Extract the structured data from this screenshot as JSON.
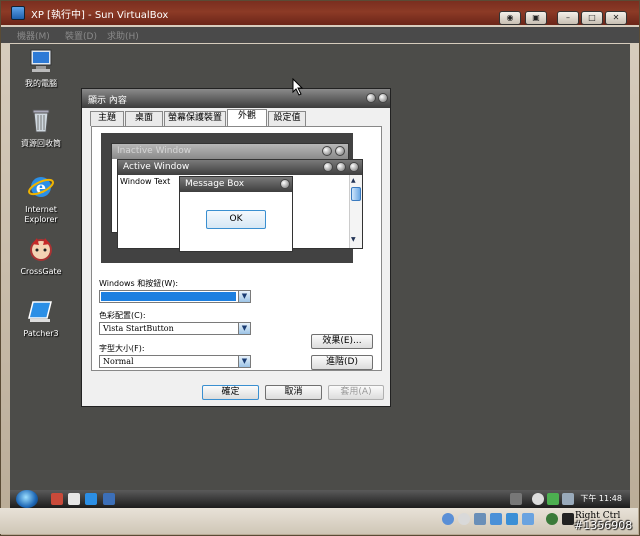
{
  "host": {
    "title": "XP [執行中] - Sun VirtualBox",
    "menu": [
      "機器(M)",
      "裝置(D)",
      "求助(H)"
    ],
    "status_right": "Right Ctrl"
  },
  "desktop": {
    "icons": [
      {
        "label": "我的電腦",
        "icon": "my-computer-icon"
      },
      {
        "label": "資源回收筒",
        "icon": "recycle-bin-icon"
      },
      {
        "label": "Internet\nExplorer",
        "label1": "Internet",
        "label2": "Explorer",
        "icon": "internet-explorer-icon"
      },
      {
        "label": "CrossGate",
        "icon": "crossgate-icon"
      },
      {
        "label": "Patcher3",
        "icon": "patcher-icon"
      }
    ]
  },
  "dialog": {
    "title": "顯示 內容",
    "tabs": [
      "主題",
      "桌面",
      "螢幕保護裝置",
      "外觀",
      "設定值"
    ],
    "active_tab": "外觀",
    "preview": {
      "inactive_title": "Inactive Window",
      "active_title": "Active Window",
      "window_text": "Window Text",
      "message_title": "Message Box",
      "ok_label": "OK"
    },
    "fields": {
      "windows_buttons_label": "Windows 和按鈕(W):",
      "windows_buttons_value": "",
      "color_scheme_label": "色彩配置(C):",
      "color_scheme_value": "Vista StartButton",
      "font_size_label": "字型大小(F):",
      "font_size_value": "Normal"
    },
    "buttons": {
      "effects": "效果(E)...",
      "advanced": "進階(D)",
      "ok": "確定",
      "cancel": "取消",
      "apply": "套用(A)"
    }
  },
  "taskbar": {
    "clock": "下午 11:48"
  },
  "watermark": "#1356908",
  "colors": {
    "desktop": "#4c4c49",
    "selection": "#1c7fe0",
    "host_titlebar": "#7a2e1f"
  }
}
